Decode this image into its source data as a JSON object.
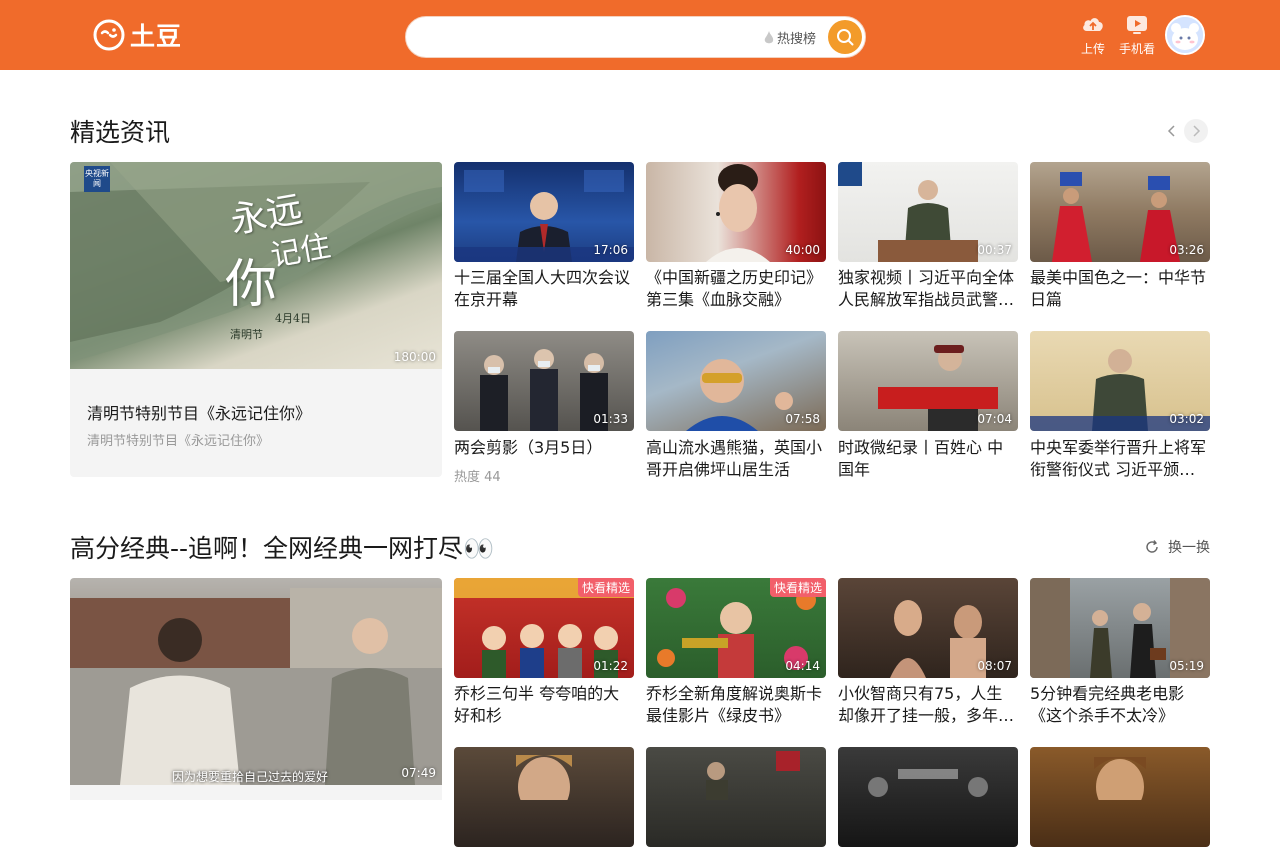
{
  "header": {
    "logo_text": "土豆",
    "search_placeholder": "",
    "hot_label": "热搜榜",
    "upload_label": "上传",
    "mobile_label": "手机看",
    "brand_color": "#f06b2b"
  },
  "section1": {
    "title": "精选资讯",
    "feature": {
      "duration": "180:00",
      "title": "清明节特别节目《永远记住你》",
      "subtitle": "清明节特别节目《永远记住你》",
      "art_text_1": "永远",
      "art_text_2": "记住",
      "art_text_3": "你",
      "art_date": "4月4日",
      "art_festival": "清明节",
      "corner_logo": "央视新闻"
    },
    "cards": [
      {
        "duration": "17:06",
        "title": "十三届全国人大四次会议在京开幕"
      },
      {
        "duration": "40:00",
        "title": "《中国新疆之历史印记》第三集《血脉交融》"
      },
      {
        "duration": "00:37",
        "title": "独家视频丨习近平向全体人民解放军指战员武警…"
      },
      {
        "duration": "03:26",
        "title": "最美中国色之一：中华节日篇"
      },
      {
        "duration": "01:33",
        "title": "两会剪影（3月5日）",
        "sub": "热度 44"
      },
      {
        "duration": "07:58",
        "title": "高山流水遇熊猫，英国小哥开启佛坪山居生活"
      },
      {
        "duration": "07:04",
        "title": "时政微纪录丨百姓心 中国年"
      },
      {
        "duration": "03:02",
        "title": "中央军委举行晋升上将军衔警衔仪式 习近平颁…"
      }
    ]
  },
  "section2": {
    "title": "高分经典--追啊！全网经典一网打尽👀",
    "refresh_label": "换一换",
    "feature": {
      "duration": "07:49",
      "caption": "因为想要重拾自己过去的爱好"
    },
    "cards": [
      {
        "duration": "01:22",
        "badge": "快看精选",
        "title": "乔杉三句半 夸夸咱的大好和杉"
      },
      {
        "duration": "04:14",
        "badge": "快看精选",
        "title": "乔杉全新角度解说奥斯卡最佳影片《绿皮书》"
      },
      {
        "duration": "08:07",
        "title": "小伙智商只有75，人生却像开了挂一般，多年后…"
      },
      {
        "duration": "05:19",
        "title": "5分钟看完经典老电影《这个杀手不太冷》"
      }
    ]
  }
}
